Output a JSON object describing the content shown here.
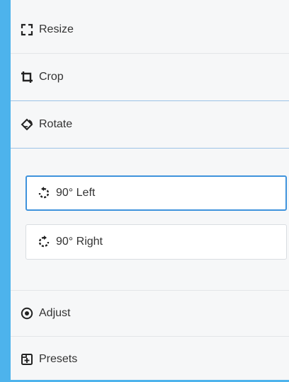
{
  "menu": {
    "resize": {
      "label": "Resize",
      "icon": "resize-icon"
    },
    "crop": {
      "label": "Crop",
      "icon": "crop-icon"
    },
    "rotate": {
      "label": "Rotate",
      "icon": "rotate-icon"
    },
    "adjust": {
      "label": "Adjust",
      "icon": "adjust-icon"
    },
    "presets": {
      "label": "Presets",
      "icon": "presets-icon"
    }
  },
  "rotate_panel": {
    "left_label": "90° Left",
    "right_label": "90° Right",
    "left_icon": "rotate-left-icon",
    "right_icon": "rotate-right-icon"
  },
  "colors": {
    "background": "#4db3ec",
    "panel": "#f6f7f8",
    "focus": "#3f93dc"
  }
}
